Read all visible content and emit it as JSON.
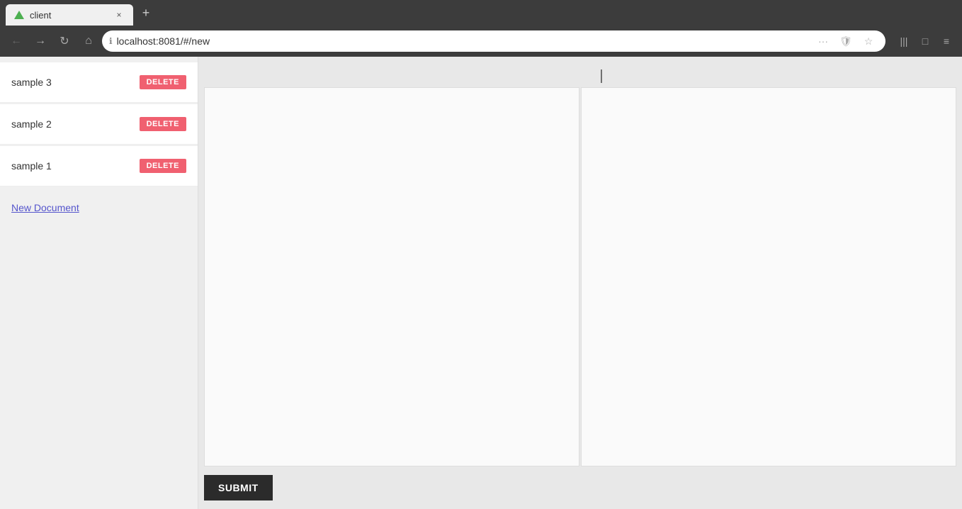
{
  "browser": {
    "tab": {
      "title": "client",
      "close_label": "×"
    },
    "new_tab_label": "+",
    "nav": {
      "back_label": "←",
      "forward_label": "→",
      "reload_label": "↻",
      "home_label": "⌂",
      "url": "localhost:8081/#/new",
      "more_label": "···",
      "bookmark_label": "☆",
      "reading_label": "📖",
      "library_label": "|||",
      "sidebar_label": "□",
      "menu_label": "≡"
    }
  },
  "sidebar": {
    "documents": [
      {
        "name": "sample 3",
        "delete_label": "DELETE"
      },
      {
        "name": "sample 2",
        "delete_label": "DELETE"
      },
      {
        "name": "sample 1",
        "delete_label": "DELETE"
      }
    ],
    "new_document_label": "New Document"
  },
  "main": {
    "submit_label": "SUBMIT"
  }
}
